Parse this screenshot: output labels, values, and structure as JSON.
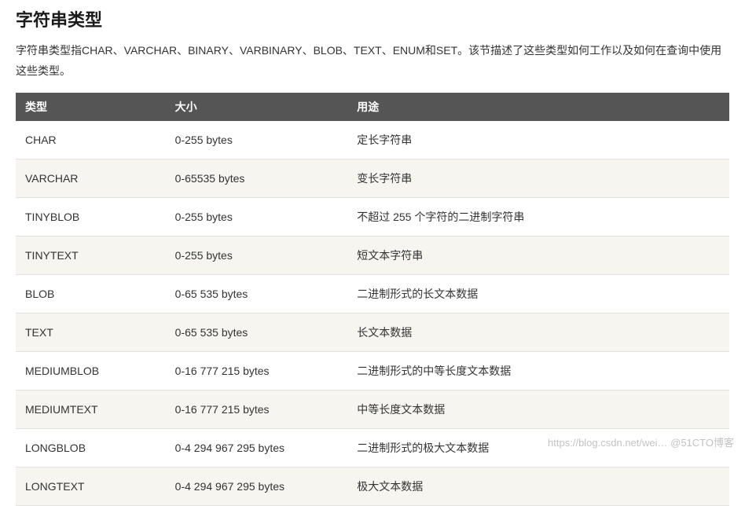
{
  "heading": "字符串类型",
  "intro": "字符串类型指CHAR、VARCHAR、BINARY、VARBINARY、BLOB、TEXT、ENUM和SET。该节描述了这些类型如何工作以及如何在查询中使用这些类型。",
  "table": {
    "headers": {
      "type": "类型",
      "size": "大小",
      "usage": "用途"
    },
    "rows": [
      {
        "type": "CHAR",
        "size": "0-255 bytes",
        "usage": "定长字符串"
      },
      {
        "type": "VARCHAR",
        "size": "0-65535 bytes",
        "usage": "变长字符串"
      },
      {
        "type": "TINYBLOB",
        "size": "0-255 bytes",
        "usage": "不超过 255 个字符的二进制字符串"
      },
      {
        "type": "TINYTEXT",
        "size": "0-255 bytes",
        "usage": "短文本字符串"
      },
      {
        "type": "BLOB",
        "size": "0-65 535 bytes",
        "usage": "二进制形式的长文本数据"
      },
      {
        "type": "TEXT",
        "size": "0-65 535 bytes",
        "usage": "长文本数据"
      },
      {
        "type": "MEDIUMBLOB",
        "size": "0-16 777 215 bytes",
        "usage": "二进制形式的中等长度文本数据"
      },
      {
        "type": "MEDIUMTEXT",
        "size": "0-16 777 215 bytes",
        "usage": "中等长度文本数据"
      },
      {
        "type": "LONGBLOB",
        "size": "0-4 294 967 295 bytes",
        "usage": "二进制形式的极大文本数据"
      },
      {
        "type": "LONGTEXT",
        "size": "0-4 294 967 295 bytes",
        "usage": "极大文本数据"
      }
    ]
  },
  "watermark": "https://blog.csdn.net/wei…   @51CTO博客"
}
